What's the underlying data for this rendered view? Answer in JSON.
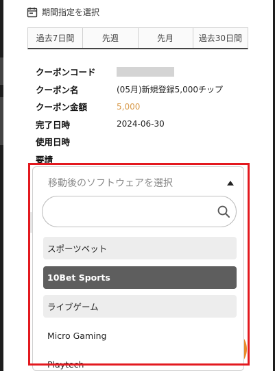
{
  "period": {
    "label": "期間指定を選択",
    "icon": "calendar-icon"
  },
  "tabs": [
    {
      "label": "過去7日間"
    },
    {
      "label": "先週"
    },
    {
      "label": "先月"
    },
    {
      "label": "過去30日間"
    }
  ],
  "coupon": {
    "code_label": "クーポンコード",
    "code_value": "",
    "name_label": "クーポン名",
    "name_value": "(05月)新規登録5,000チップ",
    "amount_label": "クーポン金額",
    "amount_value": "5,000",
    "completed_label": "完了日時",
    "completed_value": "2024-06-30",
    "used_label": "使用日時",
    "used_value": "",
    "requirement_label": "要請"
  },
  "dropdown": {
    "placeholder": "移動後のソフトウェアを選択",
    "search_placeholder": "",
    "selected": "10Bet Sports",
    "options": [
      "スポーツベット",
      "10Bet Sports",
      "ライブゲーム",
      "Micro Gaming",
      "Playtech"
    ]
  },
  "colors": {
    "highlight_frame": "#e3191f",
    "amount": "#d89a4a",
    "selected_option_bg": "#5e5e5e"
  }
}
